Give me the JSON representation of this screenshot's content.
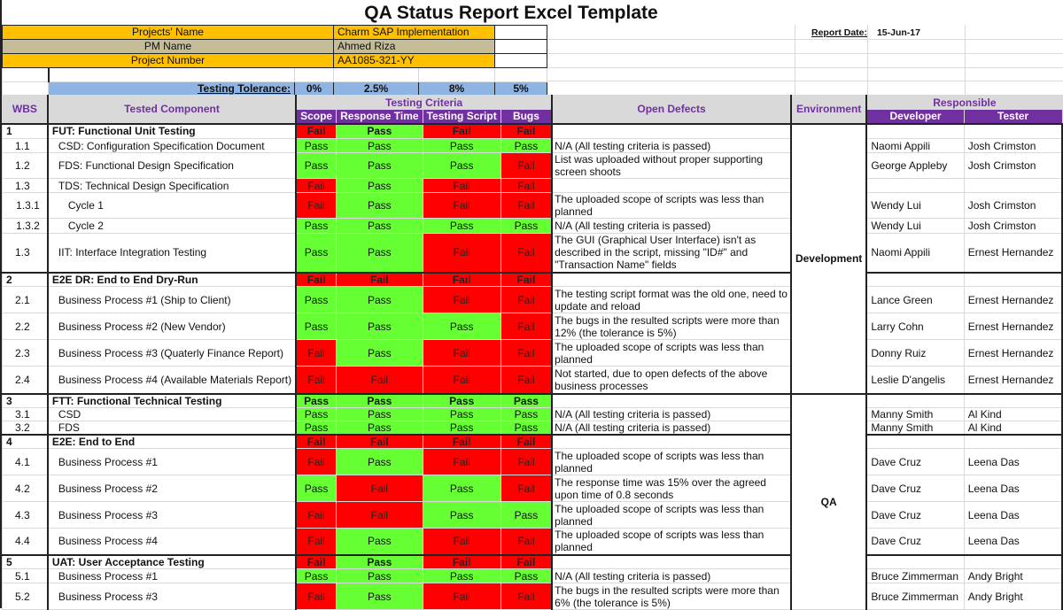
{
  "title": "QA Status Report Excel Template",
  "project_info": {
    "project_name_label": "Projects' Name",
    "project_name": "Charm SAP Implementation",
    "pm_label": "PM Name",
    "pm_name": "Ahmed Riza",
    "project_number_label": "Project Number",
    "project_number": "AA1085-321-YY",
    "report_date_label": "Report Date:",
    "report_date": "15-Jun-17"
  },
  "tolerance": {
    "label": "Testing Tolerance:",
    "scope": "0%",
    "response_time": "2.5%",
    "testing_script": "8%",
    "bugs": "5%"
  },
  "headers": {
    "wbs": "WBS",
    "component": "Tested Component",
    "criteria": "Testing Criteria",
    "scope": "Scope",
    "response_time": "Response Time",
    "testing_script": "Testing Script",
    "bugs": "Bugs",
    "defects": "Open Defects",
    "environment": "Environment",
    "responsible": "Responsible",
    "developer": "Developer",
    "tester": "Tester"
  },
  "environments": [
    "Development",
    "QA"
  ],
  "colors": {
    "pass": "#66ff33",
    "fail": "#ff0000",
    "header_purple": "#7030a0",
    "orange": "#ffc000",
    "tan": "#c4bd97",
    "blue": "#8db4e2"
  },
  "rows": [
    {
      "wbs": "1",
      "component": "FUT: Functional Unit Testing",
      "section": true,
      "scope": "Fail",
      "rt": "Pass",
      "ts": "Fail",
      "bugs": "Fail",
      "defect": "",
      "dev": "",
      "tester": ""
    },
    {
      "wbs": "1.1",
      "component": "CSD: Configuration Specification Document",
      "scope": "Pass",
      "rt": "Pass",
      "ts": "Pass",
      "bugs": "Pass",
      "defect": "N/A (All testing criteria is passed)",
      "dev": "Naomi Appili",
      "tester": "Josh Crimston"
    },
    {
      "wbs": "1.2",
      "component": "FDS: Functional Design Specification",
      "scope": "Pass",
      "rt": "Pass",
      "ts": "Pass",
      "bugs": "Fail",
      "defect": "List was uploaded without proper supporting screen shoots",
      "dev": "George Appleby",
      "tester": "Josh Crimston"
    },
    {
      "wbs": "1.3",
      "component": "TDS: Technical Design Specification",
      "scope": "Fail",
      "rt": "Pass",
      "ts": "Fail",
      "bugs": "Fail",
      "defect": "",
      "dev": "",
      "tester": ""
    },
    {
      "wbs": "1.3.1",
      "component": "Cycle 1",
      "scope": "Fail",
      "rt": "Pass",
      "ts": "Fail",
      "bugs": "Fail",
      "defect": "The uploaded scope of scripts was less than planned",
      "dev": "Wendy Lui",
      "tester": "Josh Crimston"
    },
    {
      "wbs": "1.3.2",
      "component": "Cycle 2",
      "scope": "Pass",
      "rt": "Pass",
      "ts": "Pass",
      "bugs": "Pass",
      "defect": "N/A (All testing criteria is passed)",
      "dev": "Wendy Lui",
      "tester": "Josh Crimston"
    },
    {
      "wbs": "1.3",
      "component": "IIT: Interface Integration Testing",
      "scope": "Pass",
      "rt": "Pass",
      "ts": "Fail",
      "bugs": "Fail",
      "defect": "The GUI (Graphical User Interface) isn't as described in the script, missing \"ID#\" and \"Transaction Name\" fields",
      "dev": "Naomi Appili",
      "tester": "Ernest Hernandez"
    },
    {
      "wbs": "2",
      "component": "E2E DR: End to End Dry-Run",
      "section": true,
      "scope": "Fail",
      "rt": "Fail",
      "ts": "Fail",
      "bugs": "Fail",
      "defect": "",
      "dev": "",
      "tester": ""
    },
    {
      "wbs": "2.1",
      "component": "Business Process #1 (Ship to Client)",
      "scope": "Pass",
      "rt": "Pass",
      "ts": "Fail",
      "bugs": "Fail",
      "defect": "The testing script format was the old one, need to update and reload",
      "dev": "Lance Green",
      "tester": "Ernest Hernandez"
    },
    {
      "wbs": "2.2",
      "component": "Business Process #2 (New Vendor)",
      "scope": "Pass",
      "rt": "Pass",
      "ts": "Pass",
      "bugs": "Fail",
      "defect": "The bugs in the resulted scripts were more than 12% (the tolerance is 5%)",
      "dev": "Larry Cohn",
      "tester": "Ernest Hernandez"
    },
    {
      "wbs": "2.3",
      "component": "Business Process #3 (Quaterly Finance Report)",
      "scope": "Fail",
      "rt": "Pass",
      "ts": "Fail",
      "bugs": "Fail",
      "defect": "The uploaded scope of scripts was less than planned",
      "dev": "Donny Ruiz",
      "tester": "Ernest Hernandez"
    },
    {
      "wbs": "2.4",
      "component": "Business Process #4 (Available Materials Report)",
      "scope": "Fail",
      "rt": "Fail",
      "ts": "Fail",
      "bugs": "Fail",
      "defect": "Not started, due to open defects of the above business processes",
      "dev": "Leslie D'angelis",
      "tester": "Ernest Hernandez"
    },
    {
      "wbs": "3",
      "component": "FTT: Functional Technical Testing",
      "section": true,
      "scope": "Pass",
      "rt": "Pass",
      "ts": "Pass",
      "bugs": "Pass",
      "defect": "",
      "dev": "",
      "tester": ""
    },
    {
      "wbs": "3.1",
      "component": "CSD",
      "scope": "Pass",
      "rt": "Pass",
      "ts": "Pass",
      "bugs": "Pass",
      "defect": "N/A (All testing criteria is passed)",
      "dev": "Manny Smith",
      "tester": "Al Kind"
    },
    {
      "wbs": "3.2",
      "component": "FDS",
      "scope": "Pass",
      "rt": "Pass",
      "ts": "Pass",
      "bugs": "Pass",
      "defect": "N/A (All testing criteria is passed)",
      "dev": "Manny Smith",
      "tester": "Al Kind"
    },
    {
      "wbs": "4",
      "component": "E2E: End to End",
      "section": true,
      "scope": "Fail",
      "rt": "Fail",
      "ts": "Fail",
      "bugs": "Fail",
      "defect": "",
      "dev": "",
      "tester": ""
    },
    {
      "wbs": "4.1",
      "component": "Business Process #1",
      "scope": "Fail",
      "rt": "Pass",
      "ts": "Fail",
      "bugs": "Fail",
      "defect": "The uploaded scope of scripts was less than planned",
      "dev": "Dave Cruz",
      "tester": "Leena Das"
    },
    {
      "wbs": "4.2",
      "component": "Business Process #2",
      "scope": "Pass",
      "rt": "Fail",
      "ts": "Pass",
      "bugs": "Fail",
      "defect": "The response time was 15% over the agreed upon time of 0.8 seconds",
      "dev": "Dave Cruz",
      "tester": "Leena Das"
    },
    {
      "wbs": "4.3",
      "component": "Business Process #3",
      "scope": "Fail",
      "rt": "Fail",
      "ts": "Pass",
      "bugs": "Pass",
      "defect": "The uploaded scope of scripts was less than planned",
      "dev": "Dave Cruz",
      "tester": "Leena Das"
    },
    {
      "wbs": "4.4",
      "component": "Business Process #4",
      "scope": "Fail",
      "rt": "Pass",
      "ts": "Fail",
      "bugs": "Fail",
      "defect": "The uploaded scope of scripts was less than planned",
      "dev": "Dave Cruz",
      "tester": "Leena Das"
    },
    {
      "wbs": "5",
      "component": "UAT: User Acceptance Testing",
      "section": true,
      "scope": "Fail",
      "rt": "Pass",
      "ts": "Fail",
      "bugs": "Fail",
      "defect": "",
      "dev": "",
      "tester": ""
    },
    {
      "wbs": "5.1",
      "component": "Business Process #1",
      "scope": "Pass",
      "rt": "Pass",
      "ts": "Pass",
      "bugs": "Pass",
      "defect": "N/A (All testing criteria is passed)",
      "dev": "Bruce Zimmerman",
      "tester": "Andy Bright"
    },
    {
      "wbs": "5.2",
      "component": "Business Process #3",
      "scope": "Fail",
      "rt": "Pass",
      "ts": "Fail",
      "bugs": "Fail",
      "defect": "The bugs in the resulted scripts were more than 6% (the tolerance is 5%)",
      "dev": "Bruce Zimmerman",
      "tester": "Andy Bright"
    }
  ]
}
